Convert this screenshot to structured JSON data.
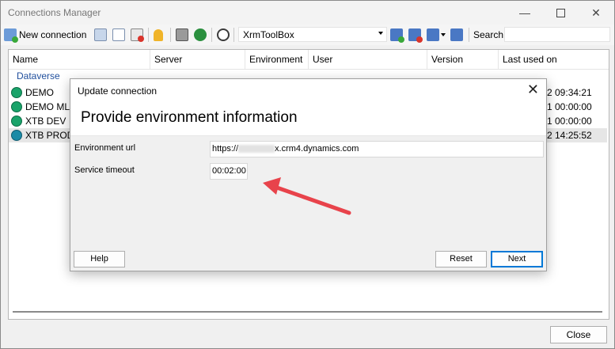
{
  "window": {
    "title": "Connections Manager"
  },
  "toolbar": {
    "new_connection_label": "New connection",
    "connection_file": "XrmToolBox",
    "search_label": "Search"
  },
  "list": {
    "columns": [
      "Name",
      "Server",
      "Environment",
      "User",
      "Version",
      "Last used on"
    ],
    "group": "Dataverse",
    "rows": [
      {
        "name": "DEMO",
        "last_used": "2 09:34:21"
      },
      {
        "name": "DEMO MLC",
        "last_used": "1 00:00:00"
      },
      {
        "name": "XTB DEV",
        "last_used": "1 00:00:00"
      },
      {
        "name": "XTB PROD",
        "last_used": "2 14:25:52"
      }
    ]
  },
  "footer": {
    "close_label": "Close"
  },
  "dialog": {
    "title": "Update connection",
    "heading": "Provide environment information",
    "env_url_label": "Environment url",
    "env_url_prefix": "https://",
    "env_url_suffix": "x.crm4.dynamics.com",
    "timeout_label": "Service timeout",
    "timeout_value": "00:02:00",
    "help_label": "Help",
    "reset_label": "Reset",
    "next_label": "Next"
  },
  "colors": {
    "annotation_arrow": "#e8434b",
    "group_header": "#1f4e9c",
    "accent": "#0078d7"
  }
}
